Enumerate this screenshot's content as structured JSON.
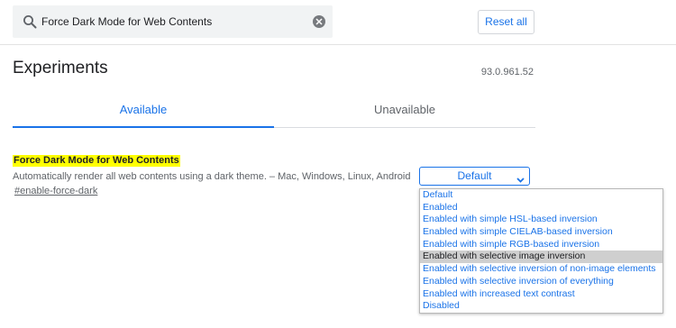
{
  "search": {
    "value": "Force Dark Mode for Web Contents",
    "icon": "search-icon",
    "clear_icon": "clear-icon"
  },
  "toolbar": {
    "reset_label": "Reset all"
  },
  "page": {
    "title": "Experiments",
    "version": "93.0.961.52"
  },
  "tabs": [
    {
      "label": "Available",
      "active": true
    },
    {
      "label": "Unavailable",
      "active": false
    }
  ],
  "experiment": {
    "title": "Force Dark Mode for Web Contents",
    "description": "Automatically render all web contents using a dark theme. – Mac, Windows, Linux, Android",
    "link": "#enable-force-dark",
    "selected_value": "Default",
    "options": [
      "Default",
      "Enabled",
      "Enabled with simple HSL-based inversion",
      "Enabled with simple CIELAB-based inversion",
      "Enabled with simple RGB-based inversion",
      "Enabled with selective image inversion",
      "Enabled with selective inversion of non-image elements",
      "Enabled with selective inversion of everything",
      "Enabled with increased text contrast",
      "Disabled"
    ],
    "highlighted_option": "Enabled with selective image inversion"
  },
  "colors": {
    "accent": "#1a73e8",
    "highlight": "#ffff00",
    "text": "#202124",
    "muted": "#5f6368",
    "option_hover": "#cfcfcf"
  }
}
